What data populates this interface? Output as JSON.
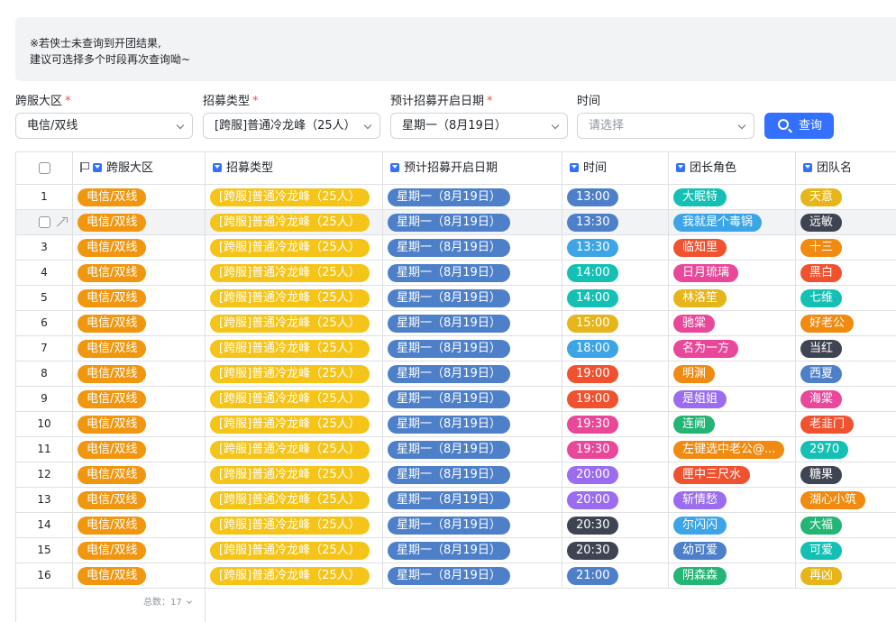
{
  "notice": {
    "line1": "※若侠士未查询到开团结果,",
    "line2": "建议可选择多个时段再次查询呦~"
  },
  "filters": {
    "server": {
      "label": "跨服大区",
      "value": "电信/双线",
      "required": true
    },
    "type": {
      "label": "招募类型",
      "value": "[跨服]普通冷龙峰（25人）",
      "required": true
    },
    "date": {
      "label": "预计招募开启日期",
      "value": "星期一（8月19日）",
      "required": true
    },
    "time": {
      "label": "时间",
      "placeholder": "请选择",
      "required": false
    },
    "query_label": "查询"
  },
  "table": {
    "columns": [
      "跨服大区",
      "招募类型",
      "预计招募开启日期",
      "时间",
      "团长角色",
      "团队名"
    ],
    "rows": [
      {
        "no": "1",
        "region": "电信/双线",
        "type": "[跨服]普通冷龙峰（25人）",
        "date": "星期一（8月19日）",
        "time": "13:00",
        "time_color": "#4e80c9",
        "leader": "大眠特",
        "leader_color": "#14c0b4",
        "team": "天意",
        "team_color": "#e6b51a"
      },
      {
        "no": "2",
        "region": "电信/双线",
        "type": "[跨服]普通冷龙峰（25人）",
        "date": "星期一（8月19日）",
        "time": "13:30",
        "time_color": "#4e80c9",
        "leader": "我就是个毒锅",
        "leader_color": "#3da5e6",
        "team": "远敏",
        "team_color": "#3f4452"
      },
      {
        "no": "3",
        "region": "电信/双线",
        "type": "[跨服]普通冷龙峰（25人）",
        "date": "星期一（8月19日）",
        "time": "13:30",
        "time_color": "#3da5e6",
        "leader": "临知里",
        "leader_color": "#f0512e",
        "team": "十三",
        "team_color": "#f08a10"
      },
      {
        "no": "4",
        "region": "电信/双线",
        "type": "[跨服]普通冷龙峰（25人）",
        "date": "星期一（8月19日）",
        "time": "14:00",
        "time_color": "#14c0b4",
        "leader": "日月琉璃",
        "leader_color": "#e8479a",
        "team": "黑白",
        "team_color": "#f0512e"
      },
      {
        "no": "5",
        "region": "电信/双线",
        "type": "[跨服]普通冷龙峰（25人）",
        "date": "星期一（8月19日）",
        "time": "14:00",
        "time_color": "#14c0b4",
        "leader": "林洛笙",
        "leader_color": "#e6b51a",
        "team": "七维",
        "team_color": "#14c0b4"
      },
      {
        "no": "6",
        "region": "电信/双线",
        "type": "[跨服]普通冷龙峰（25人）",
        "date": "星期一（8月19日）",
        "time": "15:00",
        "time_color": "#e6b51a",
        "leader": "驰棠",
        "leader_color": "#e8479a",
        "team": "好老公",
        "team_color": "#f08a10"
      },
      {
        "no": "7",
        "region": "电信/双线",
        "type": "[跨服]普通冷龙峰（25人）",
        "date": "星期一（8月19日）",
        "time": "18:00",
        "time_color": "#3da5e6",
        "leader": "名为一方",
        "leader_color": "#e8479a",
        "team": "当红",
        "team_color": "#3f4452"
      },
      {
        "no": "8",
        "region": "电信/双线",
        "type": "[跨服]普通冷龙峰（25人）",
        "date": "星期一（8月19日）",
        "time": "19:00",
        "time_color": "#f0512e",
        "leader": "明渊",
        "leader_color": "#f08a10",
        "team": "西夏",
        "team_color": "#4e80c9"
      },
      {
        "no": "9",
        "region": "电信/双线",
        "type": "[跨服]普通冷龙峰（25人）",
        "date": "星期一（8月19日）",
        "time": "19:00",
        "time_color": "#f0512e",
        "leader": "是姐姐",
        "leader_color": "#9b6cf0",
        "team": "海棠",
        "team_color": "#e8479a"
      },
      {
        "no": "10",
        "region": "电信/双线",
        "type": "[跨服]普通冷龙峰（25人）",
        "date": "星期一（8月19日）",
        "time": "19:30",
        "time_color": "#e8479a",
        "leader": "连阙",
        "leader_color": "#22b573",
        "team": "老韭门",
        "team_color": "#f0512e"
      },
      {
        "no": "11",
        "region": "电信/双线",
        "type": "[跨服]普通冷龙峰（25人）",
        "date": "星期一（8月19日）",
        "time": "19:30",
        "time_color": "#e8479a",
        "leader": "左键选中老公@...",
        "leader_color": "#f08a10",
        "team": "2970",
        "team_color": "#14c0b4"
      },
      {
        "no": "12",
        "region": "电信/双线",
        "type": "[跨服]普通冷龙峰（25人）",
        "date": "星期一（8月19日）",
        "time": "20:00",
        "time_color": "#9b6cf0",
        "leader": "匣中三尺水",
        "leader_color": "#f0512e",
        "team": "糖果",
        "team_color": "#3f4452"
      },
      {
        "no": "13",
        "region": "电信/双线",
        "type": "[跨服]普通冷龙峰（25人）",
        "date": "星期一（8月19日）",
        "time": "20:00",
        "time_color": "#9b6cf0",
        "leader": "斩情愁",
        "leader_color": "#9b6cf0",
        "team": "湖心小筑",
        "team_color": "#f08a10"
      },
      {
        "no": "14",
        "region": "电信/双线",
        "type": "[跨服]普通冷龙峰（25人）",
        "date": "星期一（8月19日）",
        "time": "20:30",
        "time_color": "#3f4452",
        "leader": "尔闪闪",
        "leader_color": "#3da5e6",
        "team": "大福",
        "team_color": "#22b573"
      },
      {
        "no": "15",
        "region": "电信/双线",
        "type": "[跨服]普通冷龙峰（25人）",
        "date": "星期一（8月19日）",
        "time": "20:30",
        "time_color": "#3f4452",
        "leader": "幼可爱",
        "leader_color": "#4e80c9",
        "team": "可爱",
        "team_color": "#14c0b4"
      },
      {
        "no": "16",
        "region": "电信/双线",
        "type": "[跨服]普通冷龙峰（25人）",
        "date": "星期一（8月19日）",
        "time": "21:00",
        "time_color": "#4e80c9",
        "leader": "阴森森",
        "leader_color": "#22b573",
        "team": "再凶",
        "team_color": "#e6b51a"
      }
    ],
    "footer_count": "总数：17"
  },
  "colors": {
    "accent": "#3370ff",
    "region_tag": "#f0960f",
    "type_tag": "#f5c419",
    "date_tag": "#4e80c9"
  }
}
